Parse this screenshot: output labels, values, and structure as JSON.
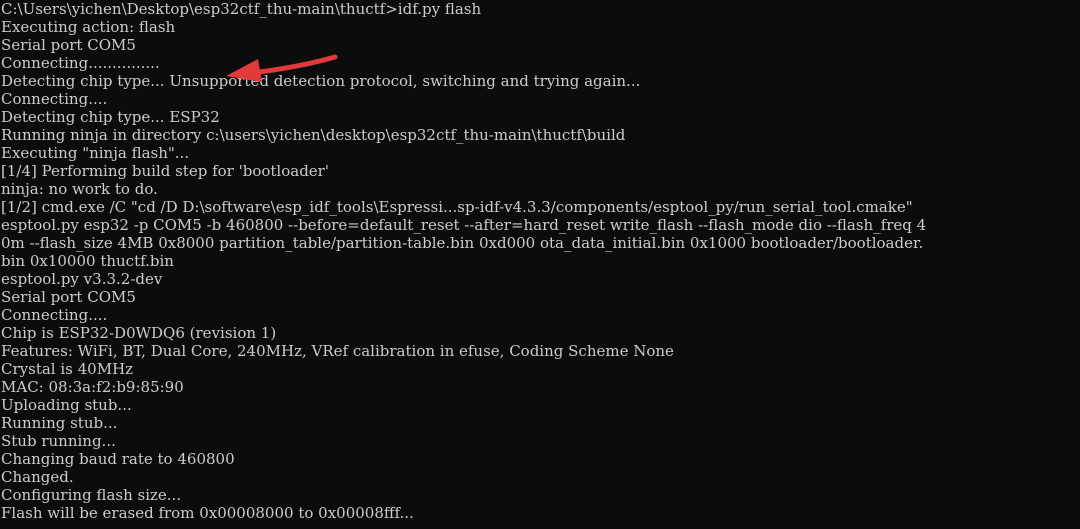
{
  "terminal": {
    "lines": [
      "C:\\Users\\yichen\\Desktop\\esp32ctf_thu-main\\thuctf>idf.py flash",
      "Executing action: flash",
      "Serial port COM5",
      "Connecting...............",
      "Detecting chip type... Unsupported detection protocol, switching and trying again...",
      "Connecting....",
      "Detecting chip type... ESP32",
      "Running ninja in directory c:\\users\\yichen\\desktop\\esp32ctf_thu-main\\thuctf\\build",
      "Executing \"ninja flash\"...",
      "[1/4] Performing build step for 'bootloader'",
      "ninja: no work to do.",
      "[1/2] cmd.exe /C \"cd /D D:\\software\\esp_idf_tools\\Espressi...sp-idf-v4.3.3/components/esptool_py/run_serial_tool.cmake\"",
      "esptool.py esp32 -p COM5 -b 460800 --before=default_reset --after=hard_reset write_flash --flash_mode dio --flash_freq 4",
      "0m --flash_size 4MB 0x8000 partition_table/partition-table.bin 0xd000 ota_data_initial.bin 0x1000 bootloader/bootloader.",
      "bin 0x10000 thuctf.bin",
      "esptool.py v3.3.2-dev",
      "Serial port COM5",
      "Connecting....",
      "Chip is ESP32-D0WDQ6 (revision 1)",
      "Features: WiFi, BT, Dual Core, 240MHz, VRef calibration in efuse, Coding Scheme None",
      "Crystal is 40MHz",
      "MAC: 08:3a:f2:b9:85:90",
      "Uploading stub...",
      "Running stub...",
      "Stub running...",
      "Changing baud rate to 460800",
      "Changed.",
      "Configuring flash size...",
      "Flash will be erased from 0x00008000 to 0x00008fff..."
    ]
  },
  "colors": {
    "background": "#0c0c0c",
    "text": "#cccccc",
    "annotation_arrow": "#e03a3a"
  },
  "annotation": {
    "icon": "red-arrow-icon"
  }
}
